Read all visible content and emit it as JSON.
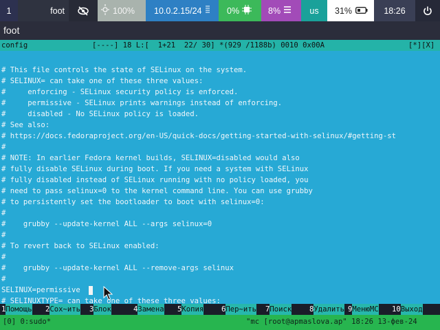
{
  "topbar": {
    "workspace": "1",
    "window_title": "foot",
    "brightness": "100%",
    "ip": "10.0.2.15/24",
    "cpu": "0%",
    "memory": "8%",
    "keyboard_layout": "us",
    "battery": "31%",
    "clock": "18:26",
    "icons": [
      "eye-off-icon",
      "brightness-icon",
      "network-icon",
      "cpu-icon",
      "memory-icon",
      "battery-icon",
      "power-icon"
    ]
  },
  "window": {
    "title": "foot"
  },
  "editor": {
    "status_file": "config",
    "status_info": "[----] 18 L:[  1+21  22/ 30] *(929 /1188b) 0010 0x00A",
    "status_flags": "[*][X]",
    "lines": [
      "",
      "# This file controls the state of SELinux on the system.",
      "# SELINUX= can take one of these three values:",
      "#     enforcing - SELinux security policy is enforced.",
      "#     permissive - SELinux prints warnings instead of enforcing.",
      "#     disabled - No SELinux policy is loaded.",
      "# See also:",
      "# https://docs.fedoraproject.org/en-US/quick-docs/getting-started-with-selinux/#getting-st",
      "#",
      "# NOTE: In earlier Fedora kernel builds, SELINUX=disabled would also",
      "# fully disable SELinux during boot. If you need a system with SELinux",
      "# fully disabled instead of SELinux running with no policy loaded, you",
      "# need to pass selinux=0 to the kernel command line. You can use grubby",
      "# to persistently set the bootloader to boot with selinux=0:",
      "#",
      "#    grubby --update-kernel ALL --args selinux=0",
      "#",
      "# To revert back to SELinux enabled:",
      "#",
      "#    grubby --update-kernel ALL --remove-args selinux",
      "#",
      "SELINUX=permissive",
      "# SELINUXTYPE= can take one of these three values:"
    ],
    "fkeys": [
      {
        "num": "1",
        "label": "Помощь"
      },
      {
        "num": "2",
        "label": "Сох~ить"
      },
      {
        "num": "3",
        "label": "Блок"
      },
      {
        "num": "4",
        "label": "Замена"
      },
      {
        "num": "5",
        "label": "Копия"
      },
      {
        "num": "6",
        "label": "Пер~ить"
      },
      {
        "num": "7",
        "label": "Поиск"
      },
      {
        "num": "8",
        "label": "Удалить"
      },
      {
        "num": "9",
        "label": "МенюMC"
      },
      {
        "num": "10",
        "label": "Выход"
      }
    ]
  },
  "tmux": {
    "left": "[0] 0:sudo*",
    "right": "\"mc [root@apmaslova.ap\" 18:26 13-фев-24"
  },
  "colors": {
    "terminal_bg": "#27a9d5",
    "status_bar": "#24b3a8",
    "tmux_bar": "#27b54f",
    "cpu_bg": "#3cb95a",
    "memory_bg": "#a24bb8",
    "network_bg": "#2e80c4"
  }
}
